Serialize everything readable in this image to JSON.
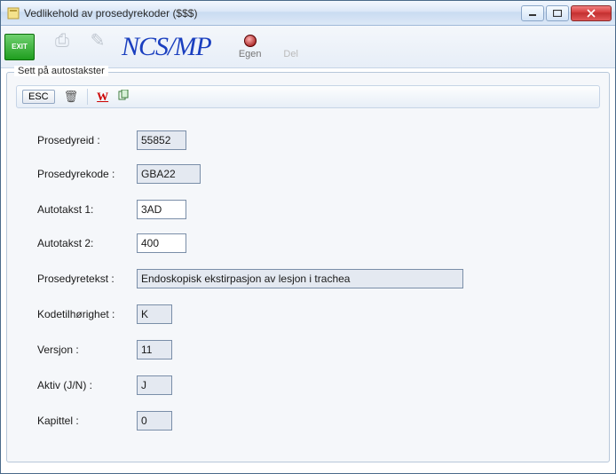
{
  "window": {
    "title": "Vedlikehold av prosedyrekoder ($$$)"
  },
  "toolbar": {
    "exit_label": "EXIT",
    "logo": "NCS/MP",
    "egen_label": "Egen",
    "del_label": "Del"
  },
  "group": {
    "title": "Sett på autostakster",
    "esc_label": "ESC"
  },
  "form": {
    "prosedyreid": {
      "label": "Prosedyreid :",
      "value": "55852"
    },
    "prosedyrekode": {
      "label": "Prosedyrekode :",
      "value": "GBA22"
    },
    "autotakst1": {
      "label": "Autotakst 1:",
      "value": "3AD"
    },
    "autotakst2": {
      "label": "Autotakst 2:",
      "value": "400"
    },
    "prosedyretekst": {
      "label": "Prosedyretekst :",
      "value": "Endoskopisk ekstirpasjon av lesjon i trachea"
    },
    "kodetilhorighet": {
      "label": "Kodetilhørighet :",
      "value": "K"
    },
    "versjon": {
      "label": "Versjon :",
      "value": "11"
    },
    "aktiv": {
      "label": "Aktiv (J/N) :",
      "value": "J"
    },
    "kapittel": {
      "label": "Kapittel :",
      "value": "0"
    }
  }
}
